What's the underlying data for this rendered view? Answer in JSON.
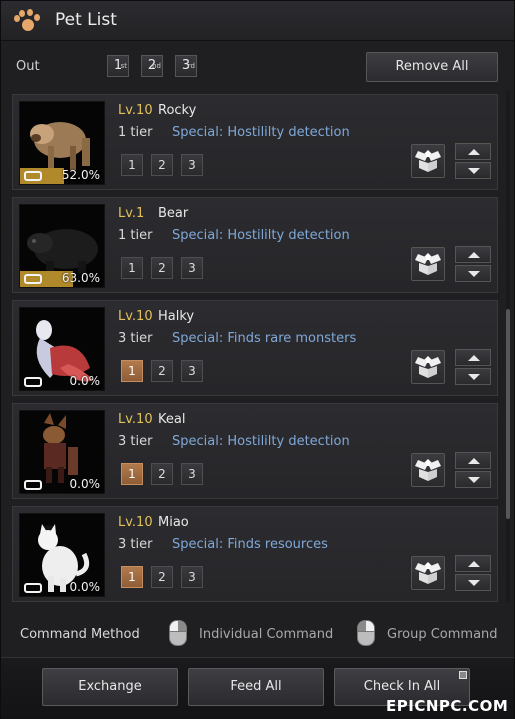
{
  "window": {
    "title": "Pet List"
  },
  "out_row": {
    "label": "Out",
    "slots": [
      {
        "label": "1",
        "sup": "st"
      },
      {
        "label": "2",
        "sup": "nd"
      },
      {
        "label": "3",
        "sup": "rd"
      }
    ],
    "remove_all_label": "Remove All"
  },
  "pets": [
    {
      "level": "Lv.10",
      "name": "Rocky",
      "tier": "1 tier",
      "special": "Special: Hostililty detection",
      "food_pct_text": "52.0%",
      "food_level": 0.52,
      "active_slot": null,
      "image": "skeletal-beast"
    },
    {
      "level": "Lv.1",
      "name": "Bear",
      "tier": "1 tier",
      "special": "Special: Hostililty detection",
      "food_pct_text": "63.0%",
      "food_level": 0.63,
      "active_slot": null,
      "image": "black-bear"
    },
    {
      "level": "Lv.10",
      "name": "Halky",
      "tier": "3 tier",
      "special": "Special: Finds rare monsters",
      "food_pct_text": "0.0%",
      "food_level": 0.0,
      "active_slot": 1,
      "image": "red-hawk"
    },
    {
      "level": "Lv.10",
      "name": "Keal",
      "tier": "3 tier",
      "special": "Special: Hostililty detection",
      "food_pct_text": "0.0%",
      "food_level": 0.0,
      "active_slot": 1,
      "image": "armored-fox"
    },
    {
      "level": "Lv.10",
      "name": "Miao",
      "tier": "3 tier",
      "special": "Special: Finds resources",
      "food_pct_text": "0.0%",
      "food_level": 0.0,
      "active_slot": 1,
      "image": "white-cat"
    }
  ],
  "slot_buttons": [
    "1",
    "2",
    "3"
  ],
  "command_method": {
    "label": "Command Method",
    "options": [
      "Individual Command",
      "Group Command"
    ]
  },
  "footer": {
    "exchange_label": "Exchange",
    "feed_all_label": "Feed All",
    "check_in_all_label": "Check In All"
  },
  "watermark": "EPICNPC.COM",
  "colors": {
    "level": "#e2c15a",
    "special": "#7fa8d8",
    "active_slot": "#b27a4c",
    "food_bar": "#b08a2a"
  }
}
